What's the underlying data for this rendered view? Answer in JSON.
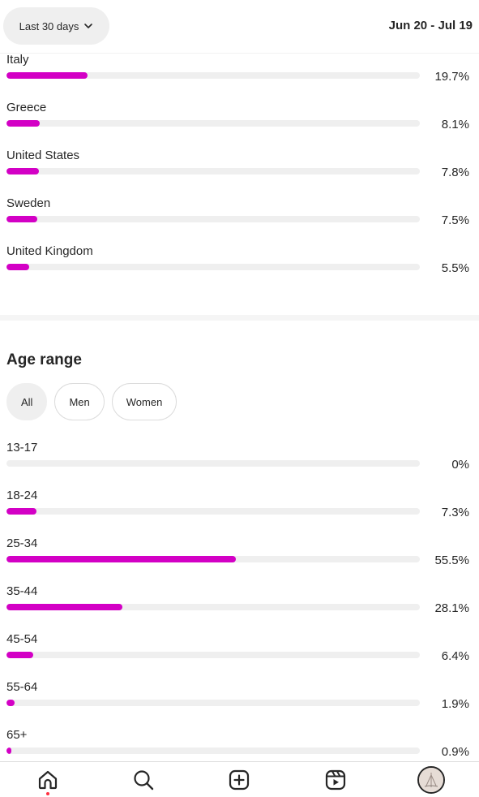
{
  "header": {
    "range_label": "Last 30 days",
    "date_range": "Jun 20 - Jul 19"
  },
  "countries": [
    {
      "label": "Italy",
      "pct": "19.7%",
      "value": 19.7
    },
    {
      "label": "Greece",
      "pct": "8.1%",
      "value": 8.1
    },
    {
      "label": "United States",
      "pct": "7.8%",
      "value": 7.8
    },
    {
      "label": "Sweden",
      "pct": "7.5%",
      "value": 7.5
    },
    {
      "label": "United Kingdom",
      "pct": "5.5%",
      "value": 5.5
    }
  ],
  "age_section": {
    "title": "Age range",
    "chips": [
      {
        "label": "All",
        "active": true
      },
      {
        "label": "Men",
        "active": false
      },
      {
        "label": "Women",
        "active": false
      }
    ],
    "rows": [
      {
        "label": "13-17",
        "pct": "0%",
        "value": 0
      },
      {
        "label": "18-24",
        "pct": "7.3%",
        "value": 7.3
      },
      {
        "label": "25-34",
        "pct": "55.5%",
        "value": 55.5
      },
      {
        "label": "35-44",
        "pct": "28.1%",
        "value": 28.1
      },
      {
        "label": "45-54",
        "pct": "6.4%",
        "value": 6.4
      },
      {
        "label": "55-64",
        "pct": "1.9%",
        "value": 1.9
      },
      {
        "label": "65+",
        "pct": "0.9%",
        "value": 0.9
      }
    ]
  },
  "colors": {
    "bar_fill": "#d300c5",
    "bar_track": "#efefef",
    "notification_dot": "#ff3040"
  },
  "nav": {
    "items": [
      "home-icon",
      "search-icon",
      "create-icon",
      "reels-icon",
      "profile-avatar"
    ]
  }
}
